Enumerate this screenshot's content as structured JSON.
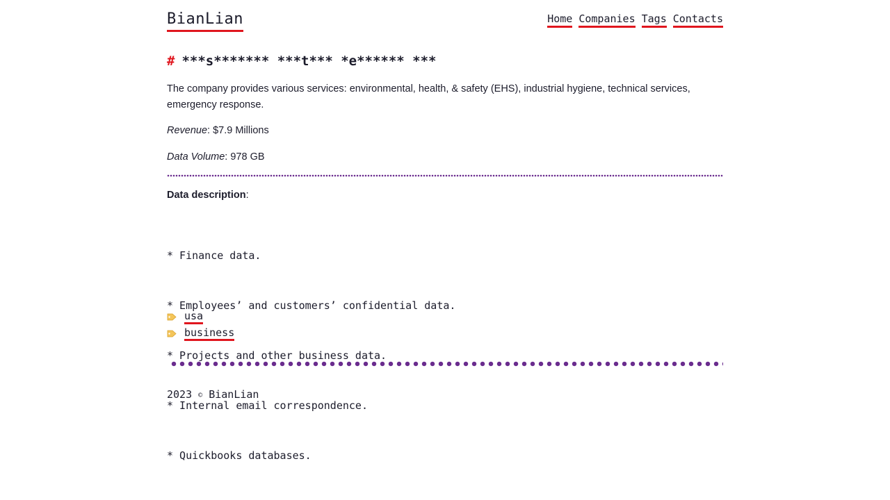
{
  "site": {
    "logo": "BianLian"
  },
  "nav": [
    {
      "label": "Home"
    },
    {
      "label": "Companies"
    },
    {
      "label": "Tags"
    },
    {
      "label": "Contacts"
    }
  ],
  "post": {
    "hash": "#",
    "title": "***s******* ***t*** *e****** ***",
    "description": "The company provides various services: environmental, health, & safety (EHS), industrial hygiene, technical services, emergency response.",
    "revenue_label": "Revenue",
    "revenue_value": ": $7.9 Millions",
    "volume_label": "Data Volume",
    "volume_value": ": 978 GB",
    "data_description_label": "Data description",
    "data_description_colon": ":",
    "items": [
      "* Finance data.",
      "* Employees’ and customers’ confidential data.",
      "* Projects and other business data.",
      "* Internal email correspondence.",
      "* Quickbooks databases."
    ],
    "tags": [
      {
        "icon": "tag-icon",
        "label": "usa"
      },
      {
        "icon": "tag-icon",
        "label": "business"
      }
    ]
  },
  "footer": {
    "year": "2023",
    "copyright_symbol": "©",
    "name": "BianLian"
  },
  "colors": {
    "accent_red": "#e0161e",
    "dots_purple": "#6a2c8e",
    "text": "#1c1c2b"
  }
}
